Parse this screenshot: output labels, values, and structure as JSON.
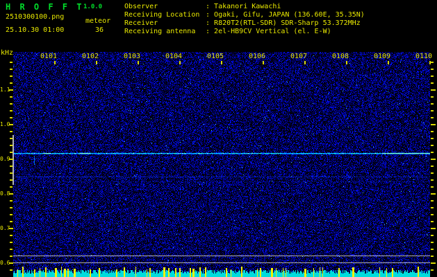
{
  "header": {
    "title": "H R O F F T",
    "version": "1.0.0",
    "filename": "2510300100.png",
    "mode_label": "meteor",
    "timestamp": "25.10.30 01:00",
    "echo_count": "36",
    "info_rows": [
      {
        "label": "Observer",
        "value": "Takanori Kawachi"
      },
      {
        "label": "Receiving Location",
        "value": "Ogaki, Gifu, JAPAN (136.60E, 35.35N)"
      },
      {
        "label": "Receiver",
        "value": "R820T2(RTL-SDR) SDR-Sharp 53.372MHz"
      },
      {
        "label": "Receiving antenna",
        "value": "2el-HB9CV Vertical (el. E-W)"
      }
    ]
  },
  "colors": {
    "background": "#000000",
    "title_green": "#00dd2a",
    "text_yellow": "#e9e900",
    "tick_yellow": "#d8d800",
    "noise_blue": "#0000e0",
    "carrier_cyan": "#7df2ff",
    "carrier_green": "#59ff8e",
    "faint_line_blue": "#1e2f9e",
    "reference_gray": "#b4b4b4",
    "meter_cyan": "#00dcdc",
    "spike_yellow": "#f2f200"
  },
  "chart_data": {
    "type": "heatmap",
    "subtype": "radio-meteor-echo-spectrogram",
    "title": "",
    "ylabel": "kHz",
    "y_tick_labels": [
      "1.1",
      "1.0",
      "0.9",
      "0.8",
      "0.7",
      "0.6"
    ],
    "y_tick_khz": [
      1.1,
      1.0,
      0.9,
      0.8,
      0.7,
      0.6
    ],
    "y_minor_tick_step_khz": 0.02,
    "y_range_khz": [
      0.58,
      1.21
    ],
    "x_tick_labels": [
      "0101",
      "0102",
      "0103",
      "0104",
      "0105",
      "0106",
      "0107",
      "0108",
      "0109",
      "0110"
    ],
    "x_start_hhmm": "0100",
    "x_span_minutes": 10,
    "grid": false,
    "legend": false,
    "features": {
      "carrier_line": {
        "freq_khz": 0.917,
        "from_minute": 0,
        "to_minute": 10
      },
      "faint_lines_khz": [
        0.85,
        0.836
      ],
      "reference_lines_khz": [
        0.62,
        0.6
      ],
      "detection_window_khz": [
        0.83,
        0.97
      ],
      "bright_segments_minutes": [
        [
          0.72,
          0.86
        ],
        [
          1.6,
          1.83
        ],
        [
          8.85,
          10
        ]
      ],
      "echo_streaks": [
        {
          "minute": 0.5,
          "freq_khz_range": [
            0.884,
            0.912
          ]
        }
      ],
      "noise_meter": {
        "position": "bottom",
        "description": "broadband noise level band with pulse spikes"
      }
    }
  }
}
